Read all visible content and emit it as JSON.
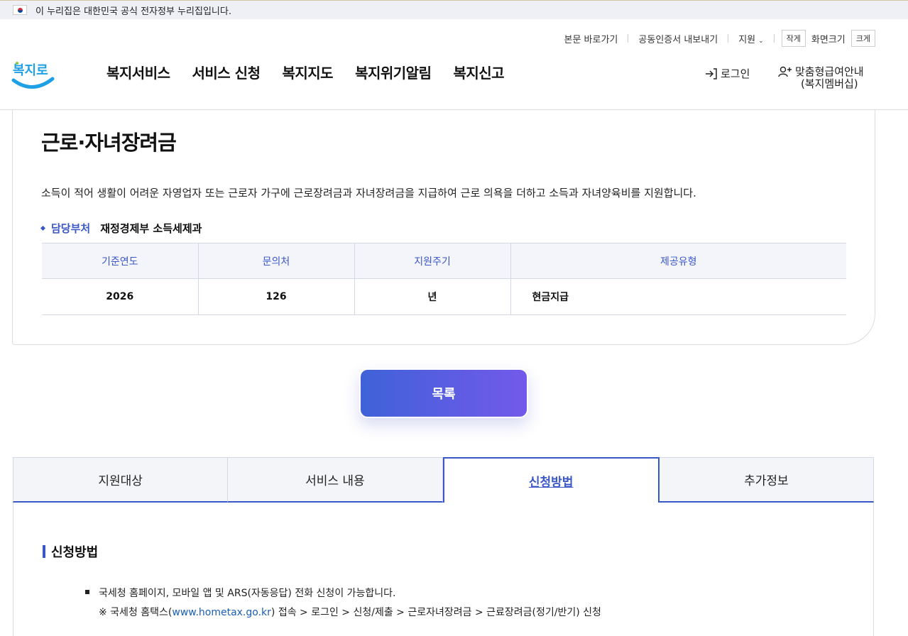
{
  "gov_banner": {
    "text": "이 누리집은 대한민국 공식 전자정부 누리집입니다."
  },
  "util_menu": {
    "skip": "본문 바로가기",
    "cert": "공동인증서 내보내기",
    "support": "지원",
    "small": "작게",
    "size_label": "화면크기",
    "large": "크게"
  },
  "logo": {
    "text": "복지로"
  },
  "gnb": [
    "복지서비스",
    "서비스 신청",
    "복지지도",
    "복지위기알림",
    "복지신고"
  ],
  "header_actions": {
    "login": "로그인",
    "member_line1": "맞춤형급여안내",
    "member_line2": "(복지멤버십)"
  },
  "detail": {
    "title": "근로·자녀장려금",
    "description": "소득이 적어 생활이 어려운 자영업자 또는 근로자 가구에 근로장려금과 자녀장려금을 지급하여 근로 의욕을 더하고 소득과 자녀양육비를 지원합니다.",
    "dept_label": "담당부처",
    "dept_value": "재정경제부 소득세제과",
    "table": {
      "headers": [
        "기준연도",
        "문의처",
        "지원주기",
        "제공유형"
      ],
      "row": [
        "2026",
        "126",
        "년",
        "현금지급"
      ]
    }
  },
  "list_button": "목록",
  "tabs": [
    {
      "label": "지원대상",
      "active": false
    },
    {
      "label": "서비스 내용",
      "active": false
    },
    {
      "label": "신청방법",
      "active": true
    },
    {
      "label": "추가정보",
      "active": false
    }
  ],
  "section": {
    "title": "신청방법",
    "line1": "국세청 홈페이지, 모바일 앱 및 ARS(자동응답) 전화 신청이 가능합니다.",
    "line2_prefix": "※ 국세청 홈택스(",
    "line2_link": "www.hometax.go.kr",
    "line2_suffix": ") 접속 > 로그인 > 신청/제출 > 근로자녀장려금 > 근료장려금(정기/반기) 신청"
  },
  "colors": {
    "accent": "#3a57c7",
    "button_start": "#3f62d8",
    "button_end": "#7359ea",
    "logo_blue": "#1ea0e6"
  }
}
